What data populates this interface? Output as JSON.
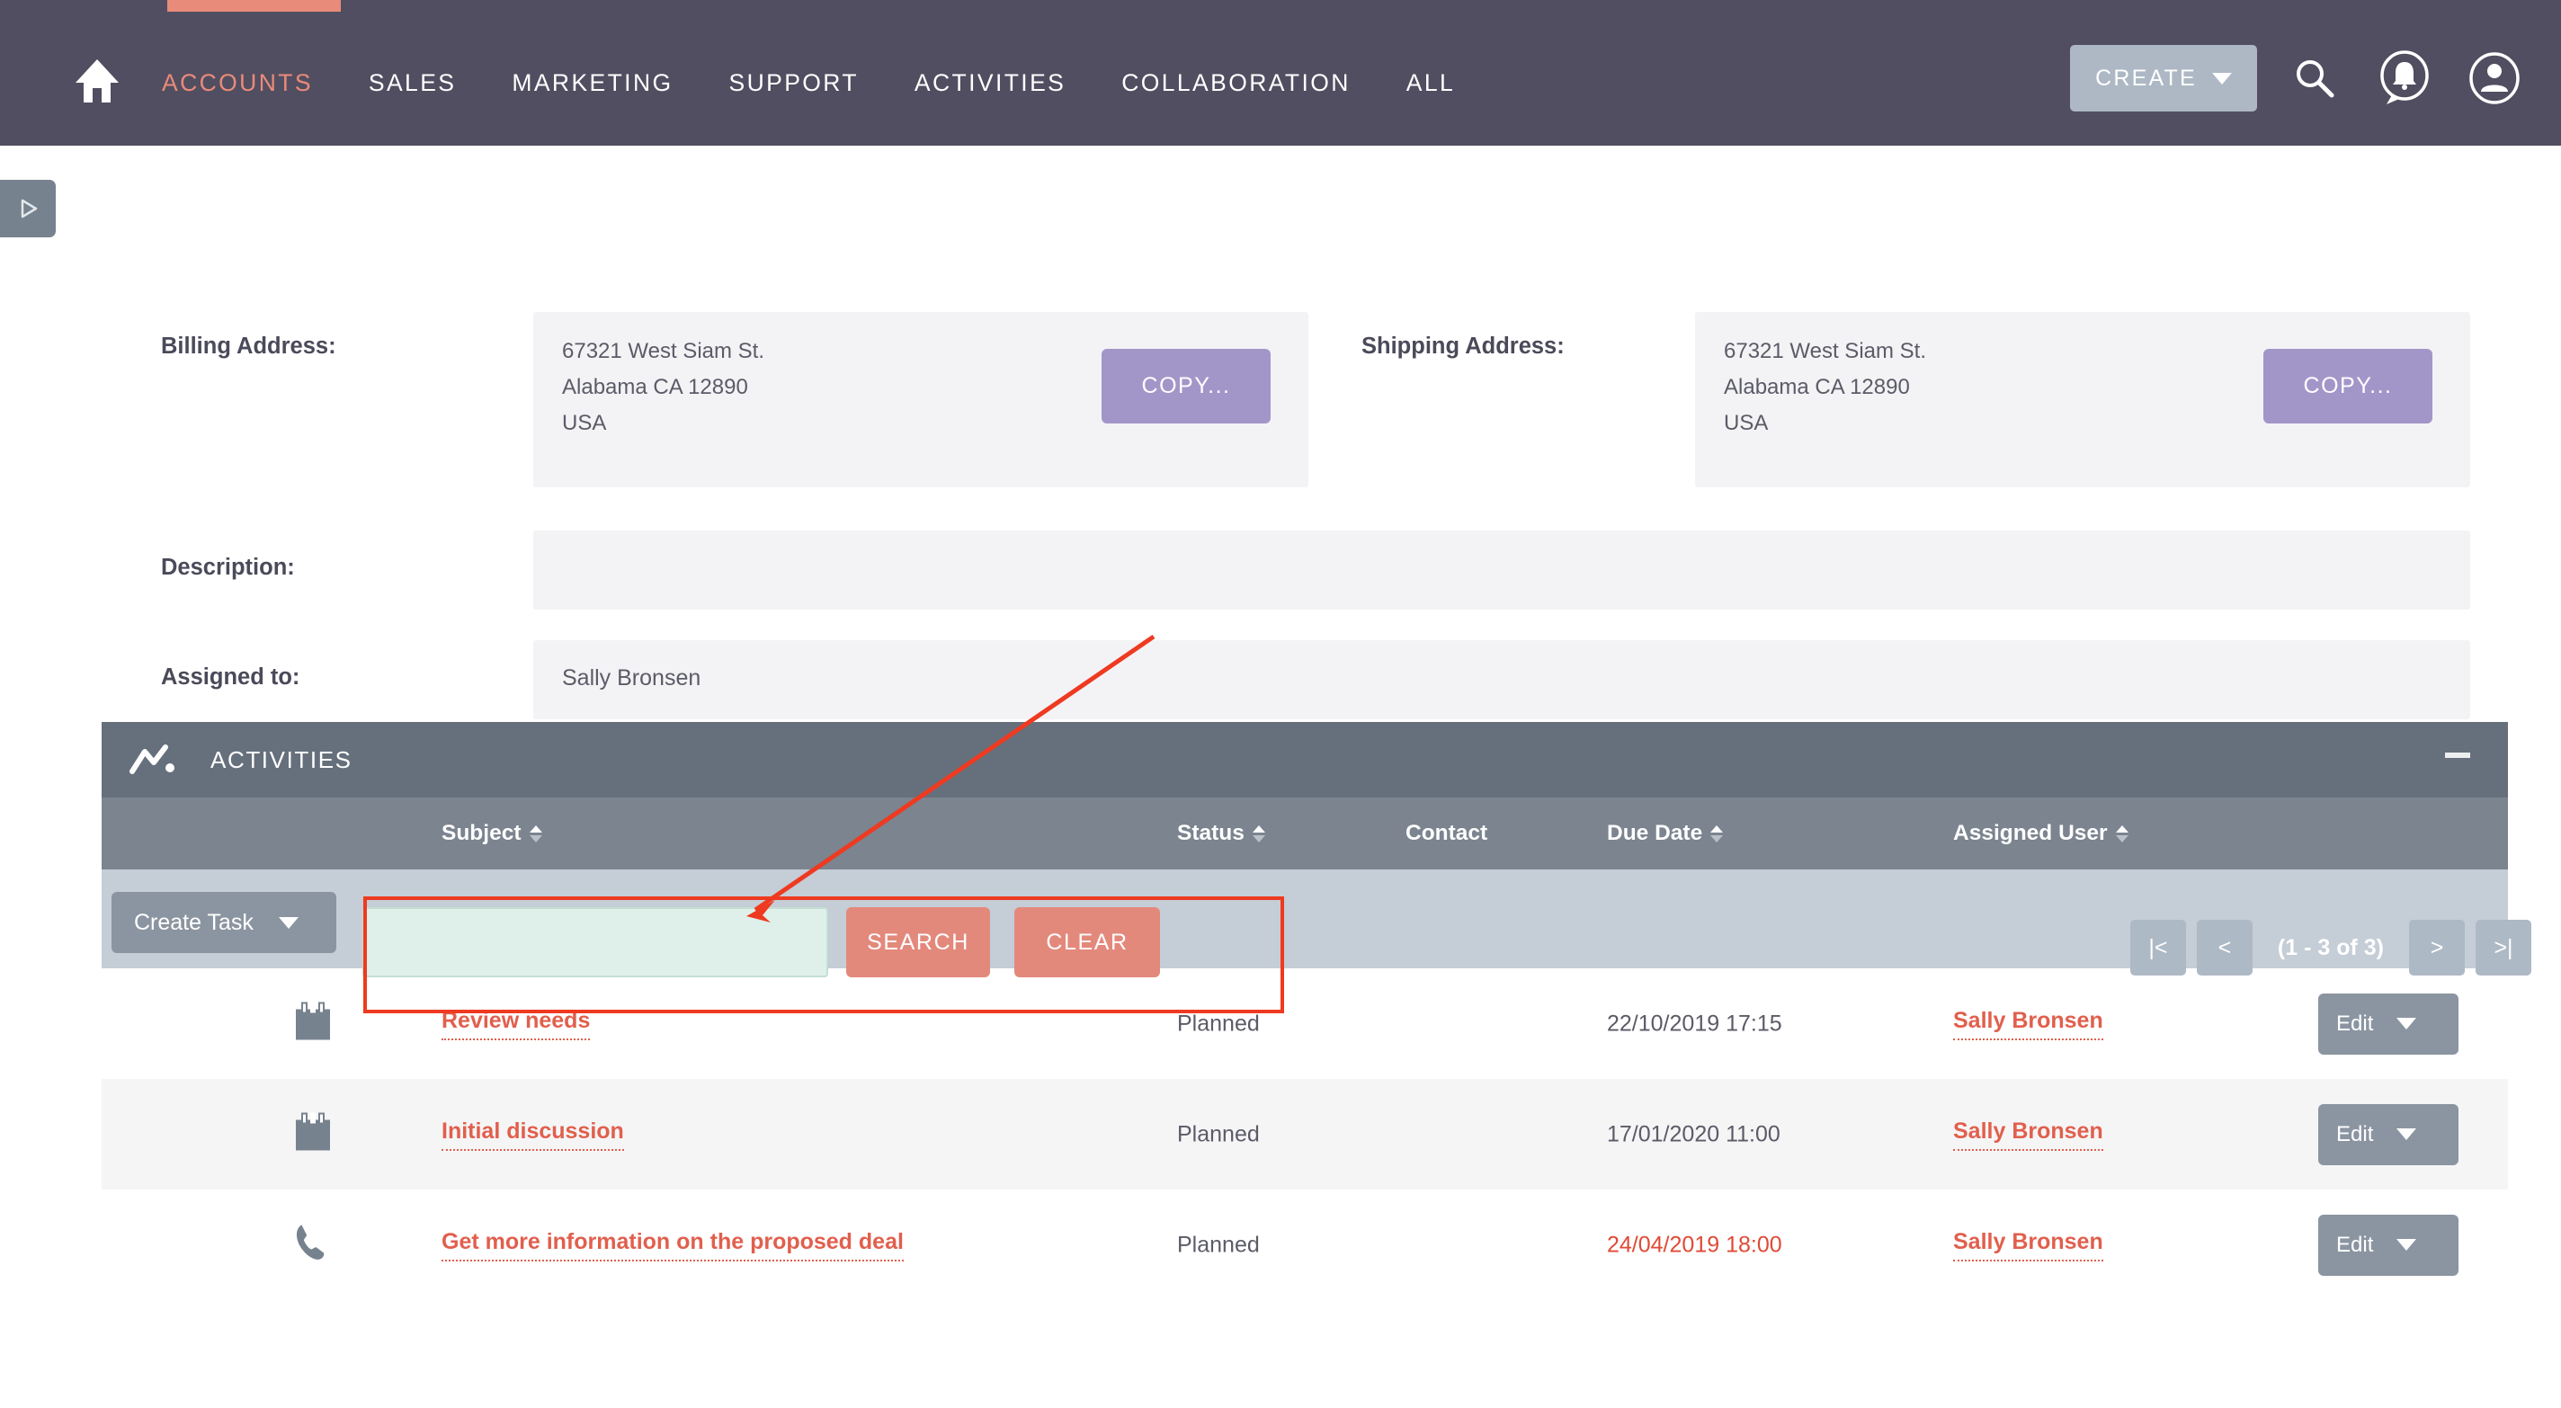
{
  "topnav": {
    "home_icon": "home-icon",
    "items": [
      {
        "label": "ACCOUNTS",
        "active": true
      },
      {
        "label": "SALES",
        "active": false
      },
      {
        "label": "MARKETING",
        "active": false
      },
      {
        "label": "SUPPORT",
        "active": false
      },
      {
        "label": "ACTIVITIES",
        "active": false
      },
      {
        "label": "COLLABORATION",
        "active": false
      },
      {
        "label": "ALL",
        "active": false
      }
    ],
    "create_label": "CREATE",
    "icons": [
      "search-icon",
      "notifications-icon",
      "user-account-icon"
    ],
    "accent_color": "#e98b7a",
    "bar_color": "#524e61"
  },
  "sidebar": {
    "toggle_icon": "expand-sidebar-icon"
  },
  "detail": {
    "billing_label": "Billing Address:",
    "billing_lines": [
      "67321 West Siam St.",
      "Alabama CA  12890",
      "USA"
    ],
    "billing_copy_label": "COPY...",
    "shipping_label": "Shipping Address:",
    "shipping_lines": [
      "67321 West Siam St.",
      "Alabama CA  12890",
      "USA"
    ],
    "shipping_copy_label": "COPY...",
    "description_label": "Description:",
    "description_value": "",
    "assigned_label": "Assigned to:",
    "assigned_value": "Sally Bronsen",
    "copy_button_color": "#a296c9"
  },
  "activities": {
    "title": "ACTIVITIES",
    "panel_icon": "activity-chart-icon",
    "collapse_icon": "minimize-icon",
    "columns": [
      {
        "label": "Subject",
        "sortable": true
      },
      {
        "label": "Status",
        "sortable": true
      },
      {
        "label": "Contact",
        "sortable": false
      },
      {
        "label": "Due Date",
        "sortable": true
      },
      {
        "label": "Assigned User",
        "sortable": true
      }
    ],
    "toolbar": {
      "create_task_label": "Create Task",
      "search_value": "",
      "search_placeholder": "",
      "search_label": "SEARCH",
      "clear_label": "CLEAR"
    },
    "pager": {
      "first_label": "|<",
      "prev_label": "<",
      "count_label": "(1 - 3 of 3)",
      "next_label": ">",
      "last_label": ">|"
    },
    "rows": [
      {
        "icon": "meeting-calendar-icon",
        "subject": "Review needs",
        "status": "Planned",
        "contact": "",
        "due_date": "22/10/2019 17:15",
        "due_overdue": false,
        "assigned_user": "Sally Bronsen",
        "edit_label": "Edit"
      },
      {
        "icon": "meeting-calendar-icon",
        "subject": "Initial discussion",
        "status": "Planned",
        "contact": "",
        "due_date": "17/01/2020 11:00",
        "due_overdue": false,
        "assigned_user": "Sally Bronsen",
        "edit_label": "Edit"
      },
      {
        "icon": "phone-call-icon",
        "subject": "Get more information on the proposed deal",
        "status": "Planned",
        "contact": "",
        "due_date": "24/04/2019 18:00",
        "due_overdue": true,
        "assigned_user": "Sally Bronsen",
        "edit_label": "Edit"
      }
    ],
    "link_color": "#e15f4d",
    "button_color": "#e3897c",
    "header_color": "#66707c"
  },
  "annotation": {
    "color": "#ee3a20",
    "target": "search-input"
  }
}
